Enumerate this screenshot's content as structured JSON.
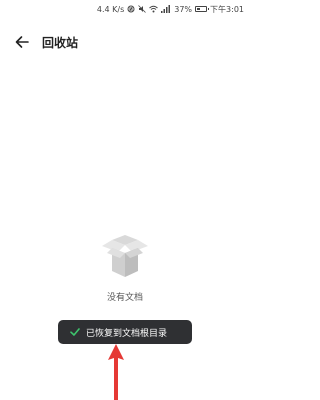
{
  "status_bar": {
    "speed": "4.4 K/s",
    "battery_percent": "37%",
    "battery_level": 0.37,
    "time": "下午3:01"
  },
  "header": {
    "title": "回收站"
  },
  "empty_state": {
    "text": "没有文档"
  },
  "toast": {
    "message": "已恢复到文档根目录"
  },
  "colors": {
    "toast_bg": "#2f3033",
    "check": "#3ec46d",
    "arrow": "#e53935"
  }
}
